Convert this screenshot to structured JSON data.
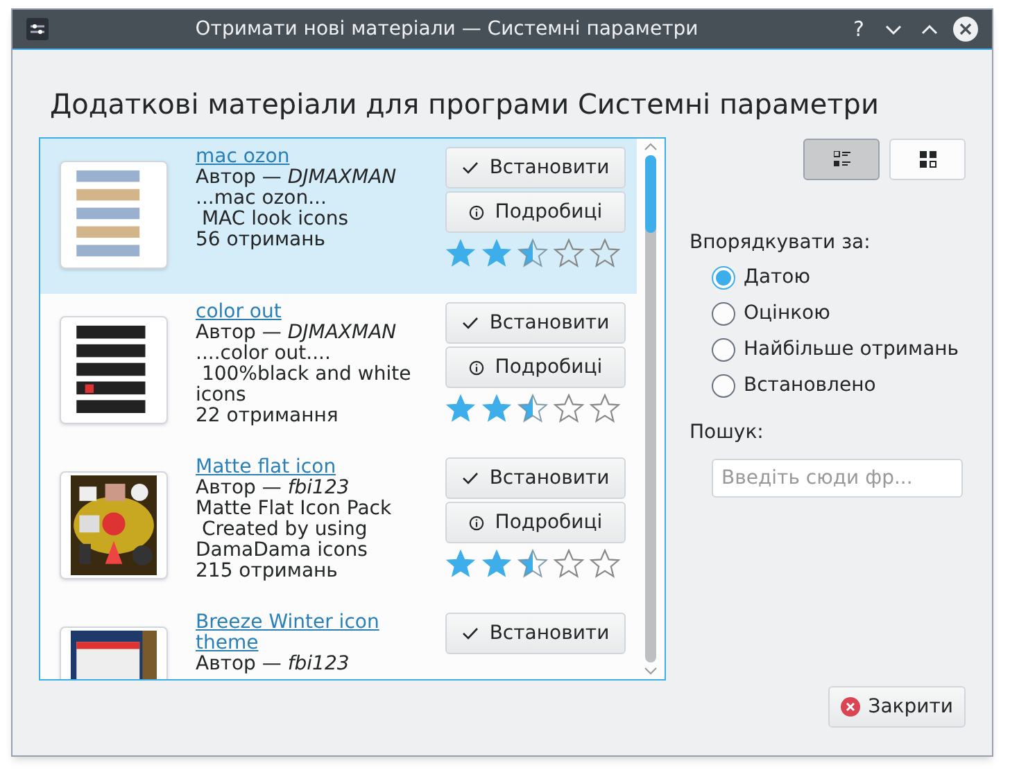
{
  "window": {
    "title": "Отримати нові матеріали — Системні параметри",
    "help": "?"
  },
  "heading": "Додаткові матеріали для програми Системні параметри",
  "items": [
    {
      "title": "mac ozon",
      "author_label": "Автор —",
      "author": "DJMAXMAN",
      "description": "...mac ozon...\n MAC look icons",
      "downloads": "56 отримань",
      "install": "Встановити",
      "details": "Подробиці",
      "stars": 2.5,
      "selected": true
    },
    {
      "title": "color out",
      "author_label": "Автор —",
      "author": "DJMAXMAN",
      "description": "....color out....\n 100%black and white icons",
      "downloads": "22 отримання",
      "install": "Встановити",
      "details": "Подробиці",
      "stars": 2.5,
      "selected": false
    },
    {
      "title": "Matte flat icon",
      "author_label": "Автор —",
      "author": "fbi123",
      "description": "Matte Flat Icon Pack\n Created by using DamaDama icons",
      "downloads": "215 отримань",
      "install": "Встановити",
      "details": "Подробиці",
      "stars": 2.5,
      "selected": false
    },
    {
      "title": "Breeze Winter icon theme",
      "author_label": "Автор —",
      "author": "fbi123",
      "install": "Встановити",
      "selected": false
    }
  ],
  "view_modes": [
    {
      "kind": "list",
      "selected": true
    },
    {
      "kind": "grid",
      "selected": false
    }
  ],
  "sort": {
    "label": "Впорядкувати за:",
    "options": [
      {
        "label": "Датою",
        "selected": true
      },
      {
        "label": "Оцінкою",
        "selected": false
      },
      {
        "label": "Найбільше отримань",
        "selected": false
      },
      {
        "label": "Встановлено",
        "selected": false
      }
    ]
  },
  "search": {
    "label": "Пошук:",
    "placeholder": "Введіть сюди фр..."
  },
  "close_button": "Закрити"
}
